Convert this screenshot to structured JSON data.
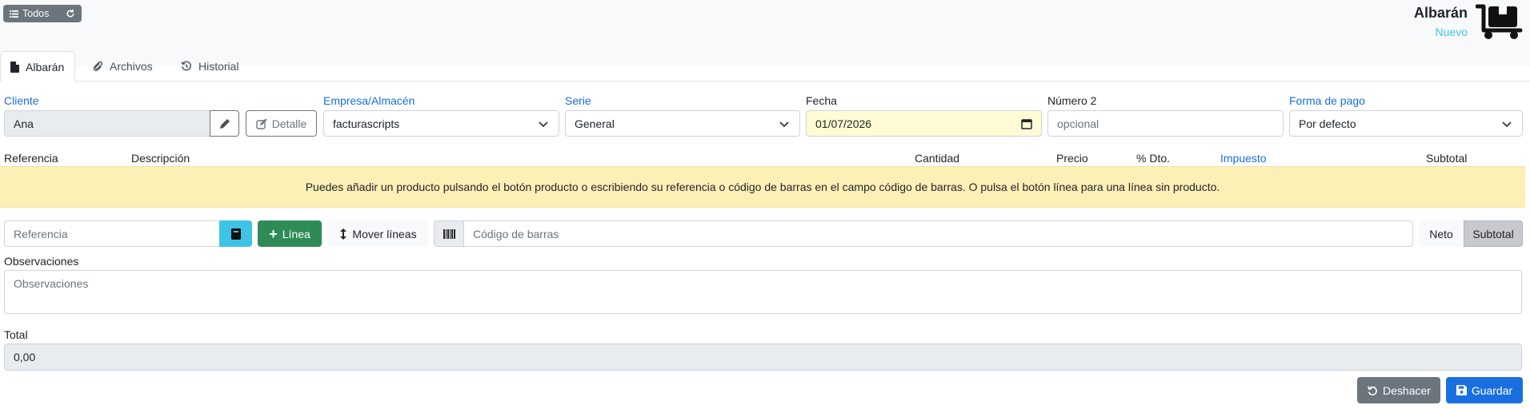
{
  "toolbar": {
    "all_label": "Todos"
  },
  "header": {
    "title": "Albarán",
    "subtitle": "Nuevo"
  },
  "tabs": [
    {
      "label": "Albarán",
      "icon": "file-icon",
      "active": true
    },
    {
      "label": "Archivos",
      "icon": "paperclip-icon",
      "active": false
    },
    {
      "label": "Historial",
      "icon": "history-icon",
      "active": false
    }
  ],
  "form": {
    "customer": {
      "label": "Cliente",
      "value": "Ana",
      "detail_label": "Detalle"
    },
    "company": {
      "label": "Empresa/Almacén",
      "value": "facturascripts"
    },
    "series": {
      "label": "Serie",
      "value": "General"
    },
    "date": {
      "label": "Fecha",
      "value": "01/07/2026"
    },
    "number2": {
      "label": "Número 2",
      "placeholder": "opcional"
    },
    "payment": {
      "label": "Forma de pago",
      "value": "Por defecto"
    }
  },
  "lines_table": {
    "headers": {
      "reference": "Referencia",
      "description": "Descripción",
      "quantity": "Cantidad",
      "price": "Precio",
      "discount": "% Dto.",
      "tax": "Impuesto",
      "subtotal": "Subtotal"
    },
    "empty_message": "Puedes añadir un producto pulsando el botón producto o escribiendo su referencia o código de barras en el campo código de barras. O pulsa el botón línea para una línea sin producto."
  },
  "line_tools": {
    "reference_placeholder": "Referencia",
    "add_line_label": "Línea",
    "move_lines_label": "Mover líneas",
    "barcode_placeholder": "Código de barras",
    "net_label": "Neto",
    "subtotal_label": "Subtotal"
  },
  "observations": {
    "label": "Observaciones",
    "placeholder": "Observaciones"
  },
  "total": {
    "label": "Total",
    "value": "0,00"
  },
  "actions": {
    "undo_label": "Deshacer",
    "save_label": "Guardar"
  },
  "colors": {
    "primary": "#1a6fe0",
    "success": "#2e8b57",
    "info": "#3ec3e6",
    "secondary": "#6c757d",
    "warning_bg": "#fdf0b6",
    "date_bg": "#fffbd5"
  }
}
